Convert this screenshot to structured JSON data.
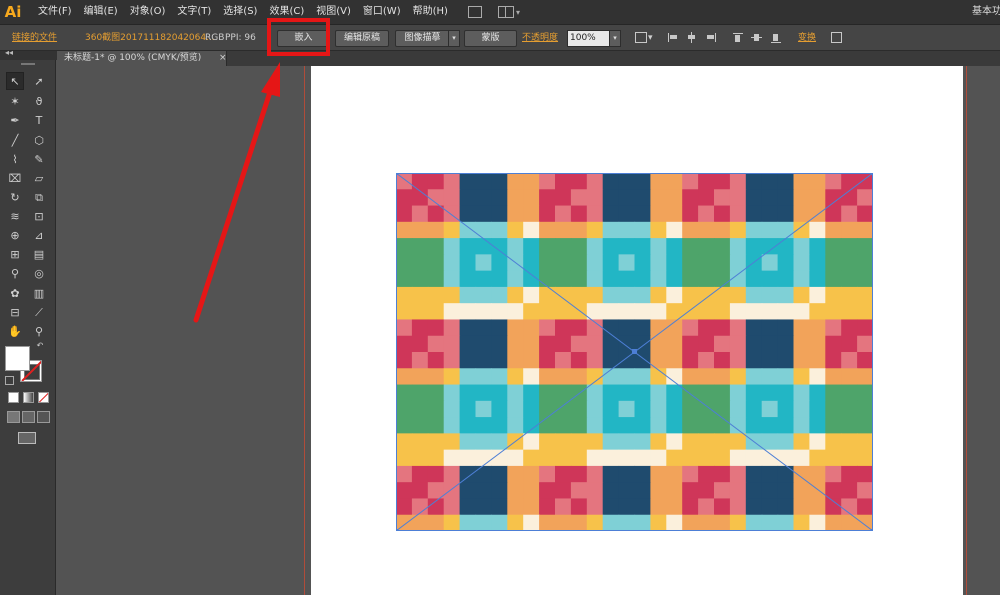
{
  "app": {
    "logo": "Ai",
    "workspace": "基本功"
  },
  "menu": {
    "items": [
      "文件(F)",
      "编辑(E)",
      "对象(O)",
      "文字(T)",
      "选择(S)",
      "效果(C)",
      "视图(V)",
      "窗口(W)",
      "帮助(H)"
    ]
  },
  "control": {
    "linked_file": "链接的文件",
    "filename": "360截图2017111820420​64...",
    "color_mode": "RGB",
    "ppi": "PPI: 96",
    "embed_label": "嵌入",
    "edit_original_label": "编辑原稿",
    "image_trace_label": "图像描摹",
    "mask_label": "蒙版",
    "opacity_label": "不透明度",
    "opacity_value": "100%",
    "transform_label": "变换"
  },
  "tab": {
    "title": "未标题-1* @ 100% (CMYK/预览)",
    "close": "×"
  },
  "toolbar": {
    "collapse": "◂◂"
  },
  "colors": {
    "red": "#cf3659",
    "rose": "#e4757f",
    "yellow": "#f7c24a",
    "cream": "#fbf0dc",
    "teal": "#22b6c5",
    "lightteal": "#7fd0d6",
    "green": "#4ea46a",
    "dark": "#1f4b6e",
    "orange": "#f2a35a",
    "accent_orange": "#e59e31",
    "highlight_red": "#e51616"
  }
}
